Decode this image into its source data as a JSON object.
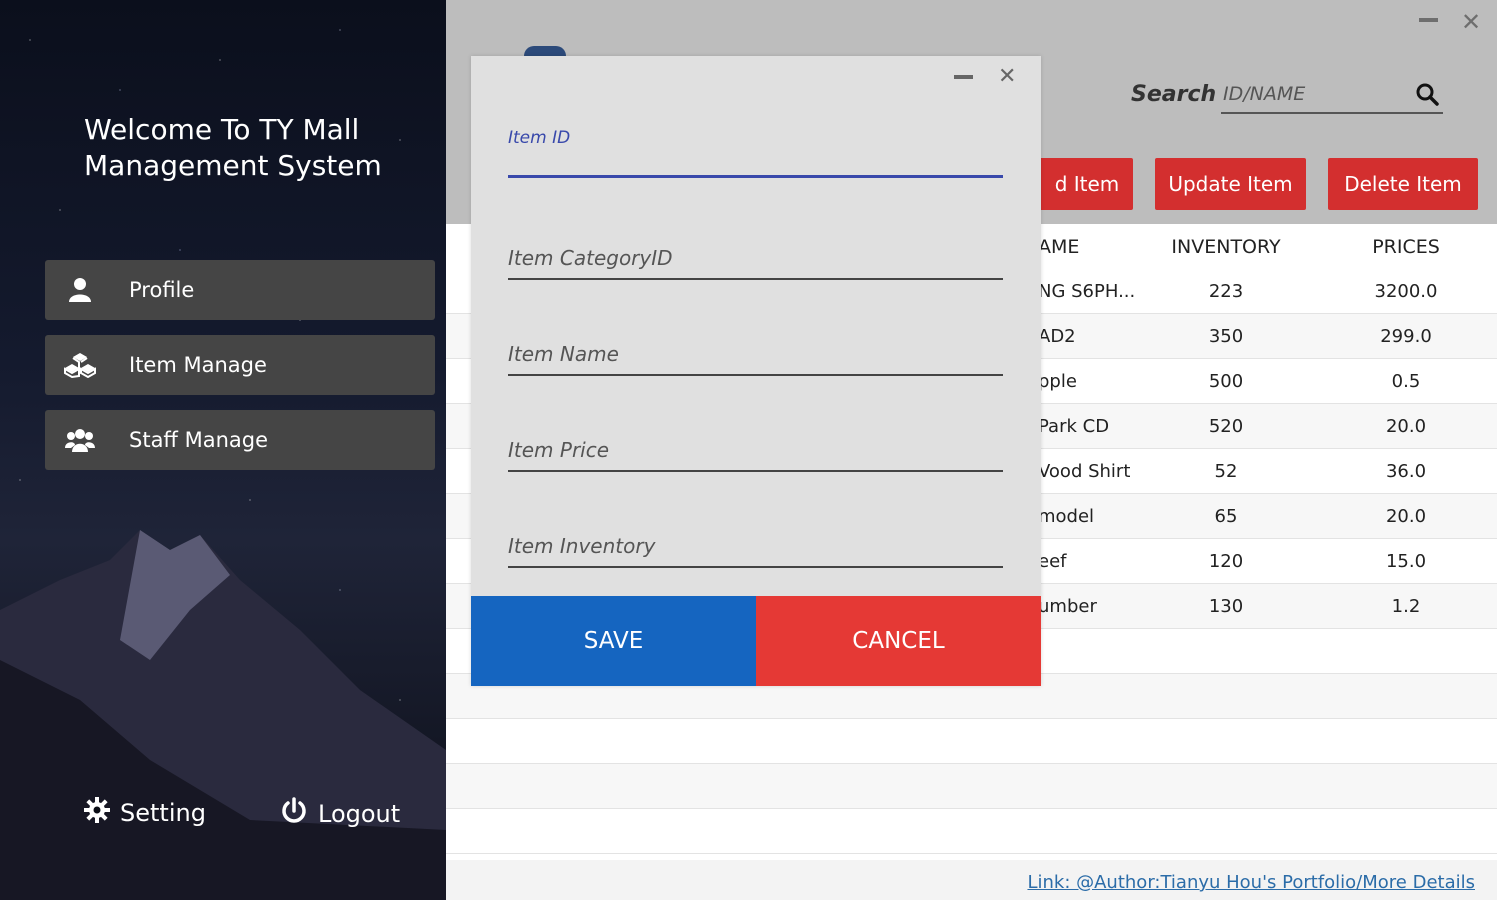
{
  "sidebar": {
    "welcome_line1": "Welcome To TY Mall",
    "welcome_line2": "Management System",
    "items": [
      {
        "label": "Profile",
        "icon": "user-icon"
      },
      {
        "label": "Item Manage",
        "icon": "cubes-icon"
      },
      {
        "label": "Staff Manage",
        "icon": "users-icon"
      }
    ],
    "setting_label": "Setting",
    "logout_label": "Logout"
  },
  "header": {
    "search_label": "Search",
    "search_placeholder": "ID/NAME",
    "add_label": "d Item",
    "update_label": "Update Item",
    "delete_label": "Delete Item"
  },
  "table": {
    "columns": [
      "AME",
      "INVENTORY",
      "PRICES"
    ],
    "rows": [
      {
        "name": "NG S6PH...",
        "inventory": "223",
        "price": "3200.0"
      },
      {
        "name": "AD2",
        "inventory": "350",
        "price": "299.0"
      },
      {
        "name": "pple",
        "inventory": "500",
        "price": "0.5"
      },
      {
        "name": "Park CD",
        "inventory": "520",
        "price": "20.0"
      },
      {
        "name": "Vood Shirt",
        "inventory": "52",
        "price": "36.0"
      },
      {
        "name": "model",
        "inventory": "65",
        "price": "20.0"
      },
      {
        "name": "eef",
        "inventory": "120",
        "price": "15.0"
      },
      {
        "name": "umber",
        "inventory": "130",
        "price": "1.2"
      }
    ]
  },
  "footer": {
    "link": "Link: @Author:Tianyu Hou's Portfolio/More Details"
  },
  "dialog": {
    "fields": {
      "item_id": "Item ID",
      "category": "Item CategoryID",
      "name": "Item Name",
      "price": "Item Price",
      "inventory": "Item Inventory"
    },
    "save_label": "SAVE",
    "cancel_label": "CANCEL"
  },
  "colors": {
    "accent_red": "#d32f2f",
    "save_blue": "#1565c0",
    "cancel_red": "#e53935",
    "active_field": "#3949ab"
  }
}
